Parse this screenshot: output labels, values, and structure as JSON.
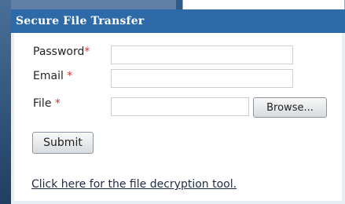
{
  "panel": {
    "title": "Secure File Transfer"
  },
  "form": {
    "password": {
      "label": "Password",
      "required": "*",
      "value": ""
    },
    "email": {
      "label": "Email ",
      "required": "*",
      "value": ""
    },
    "file": {
      "label": "File ",
      "required": "*",
      "browse_label": "Browse..."
    },
    "submit_label": "Submit"
  },
  "decrypt_link": "Click here for the file decryption tool.",
  "colors": {
    "header": "#2e6aa8",
    "required": "#d0352f",
    "background": "#2f5a86"
  }
}
